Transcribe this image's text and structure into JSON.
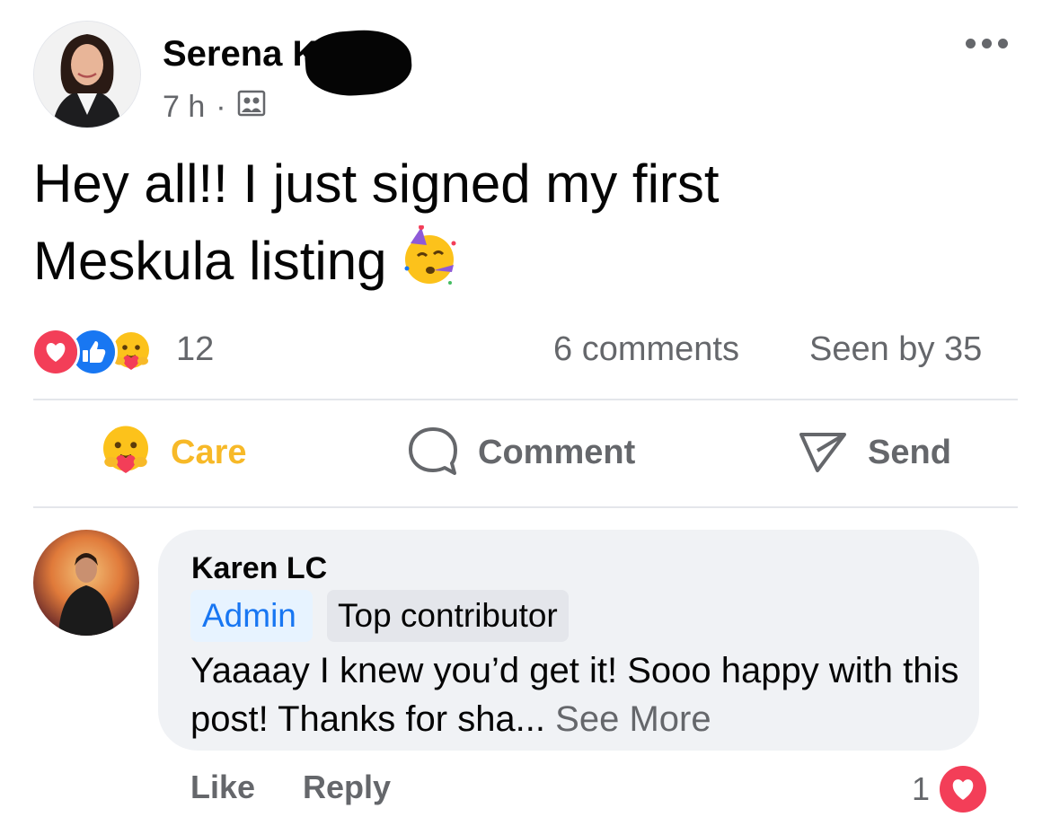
{
  "post": {
    "author": "Serena K",
    "time": "7 h",
    "separator": "·",
    "audience_icon": "group-icon",
    "text_line1": "Hey all!! I just signed my first",
    "text_line2": "Meskula listing",
    "emoji": "partying-face-emoji",
    "reaction_count": "12",
    "reaction_icons": [
      "love-reaction-icon",
      "like-reaction-icon",
      "care-reaction-icon"
    ],
    "comments_label": "6 comments",
    "seen_by_label": "Seen by 35"
  },
  "actions": {
    "care_label": "Care",
    "comment_label": "Comment",
    "send_label": "Send"
  },
  "comment": {
    "author": "Karen LC",
    "badge_admin": "Admin",
    "badge_top": "Top contributor",
    "text": "Yaaaay I knew you’d get it! Sooo happy with this post! Thanks for sha...",
    "see_more": "See More",
    "like_label": "Like",
    "reply_label": "Reply",
    "reaction_count": "1",
    "reaction_icon": "love-reaction-icon"
  },
  "colors": {
    "text_primary": "#050505",
    "text_secondary": "#65676b",
    "care_yellow": "#f7b928",
    "admin_blue": "#1876f2",
    "love_red": "#f33e58",
    "like_blue": "#1877f2",
    "bubble_bg": "#f0f2f5"
  }
}
